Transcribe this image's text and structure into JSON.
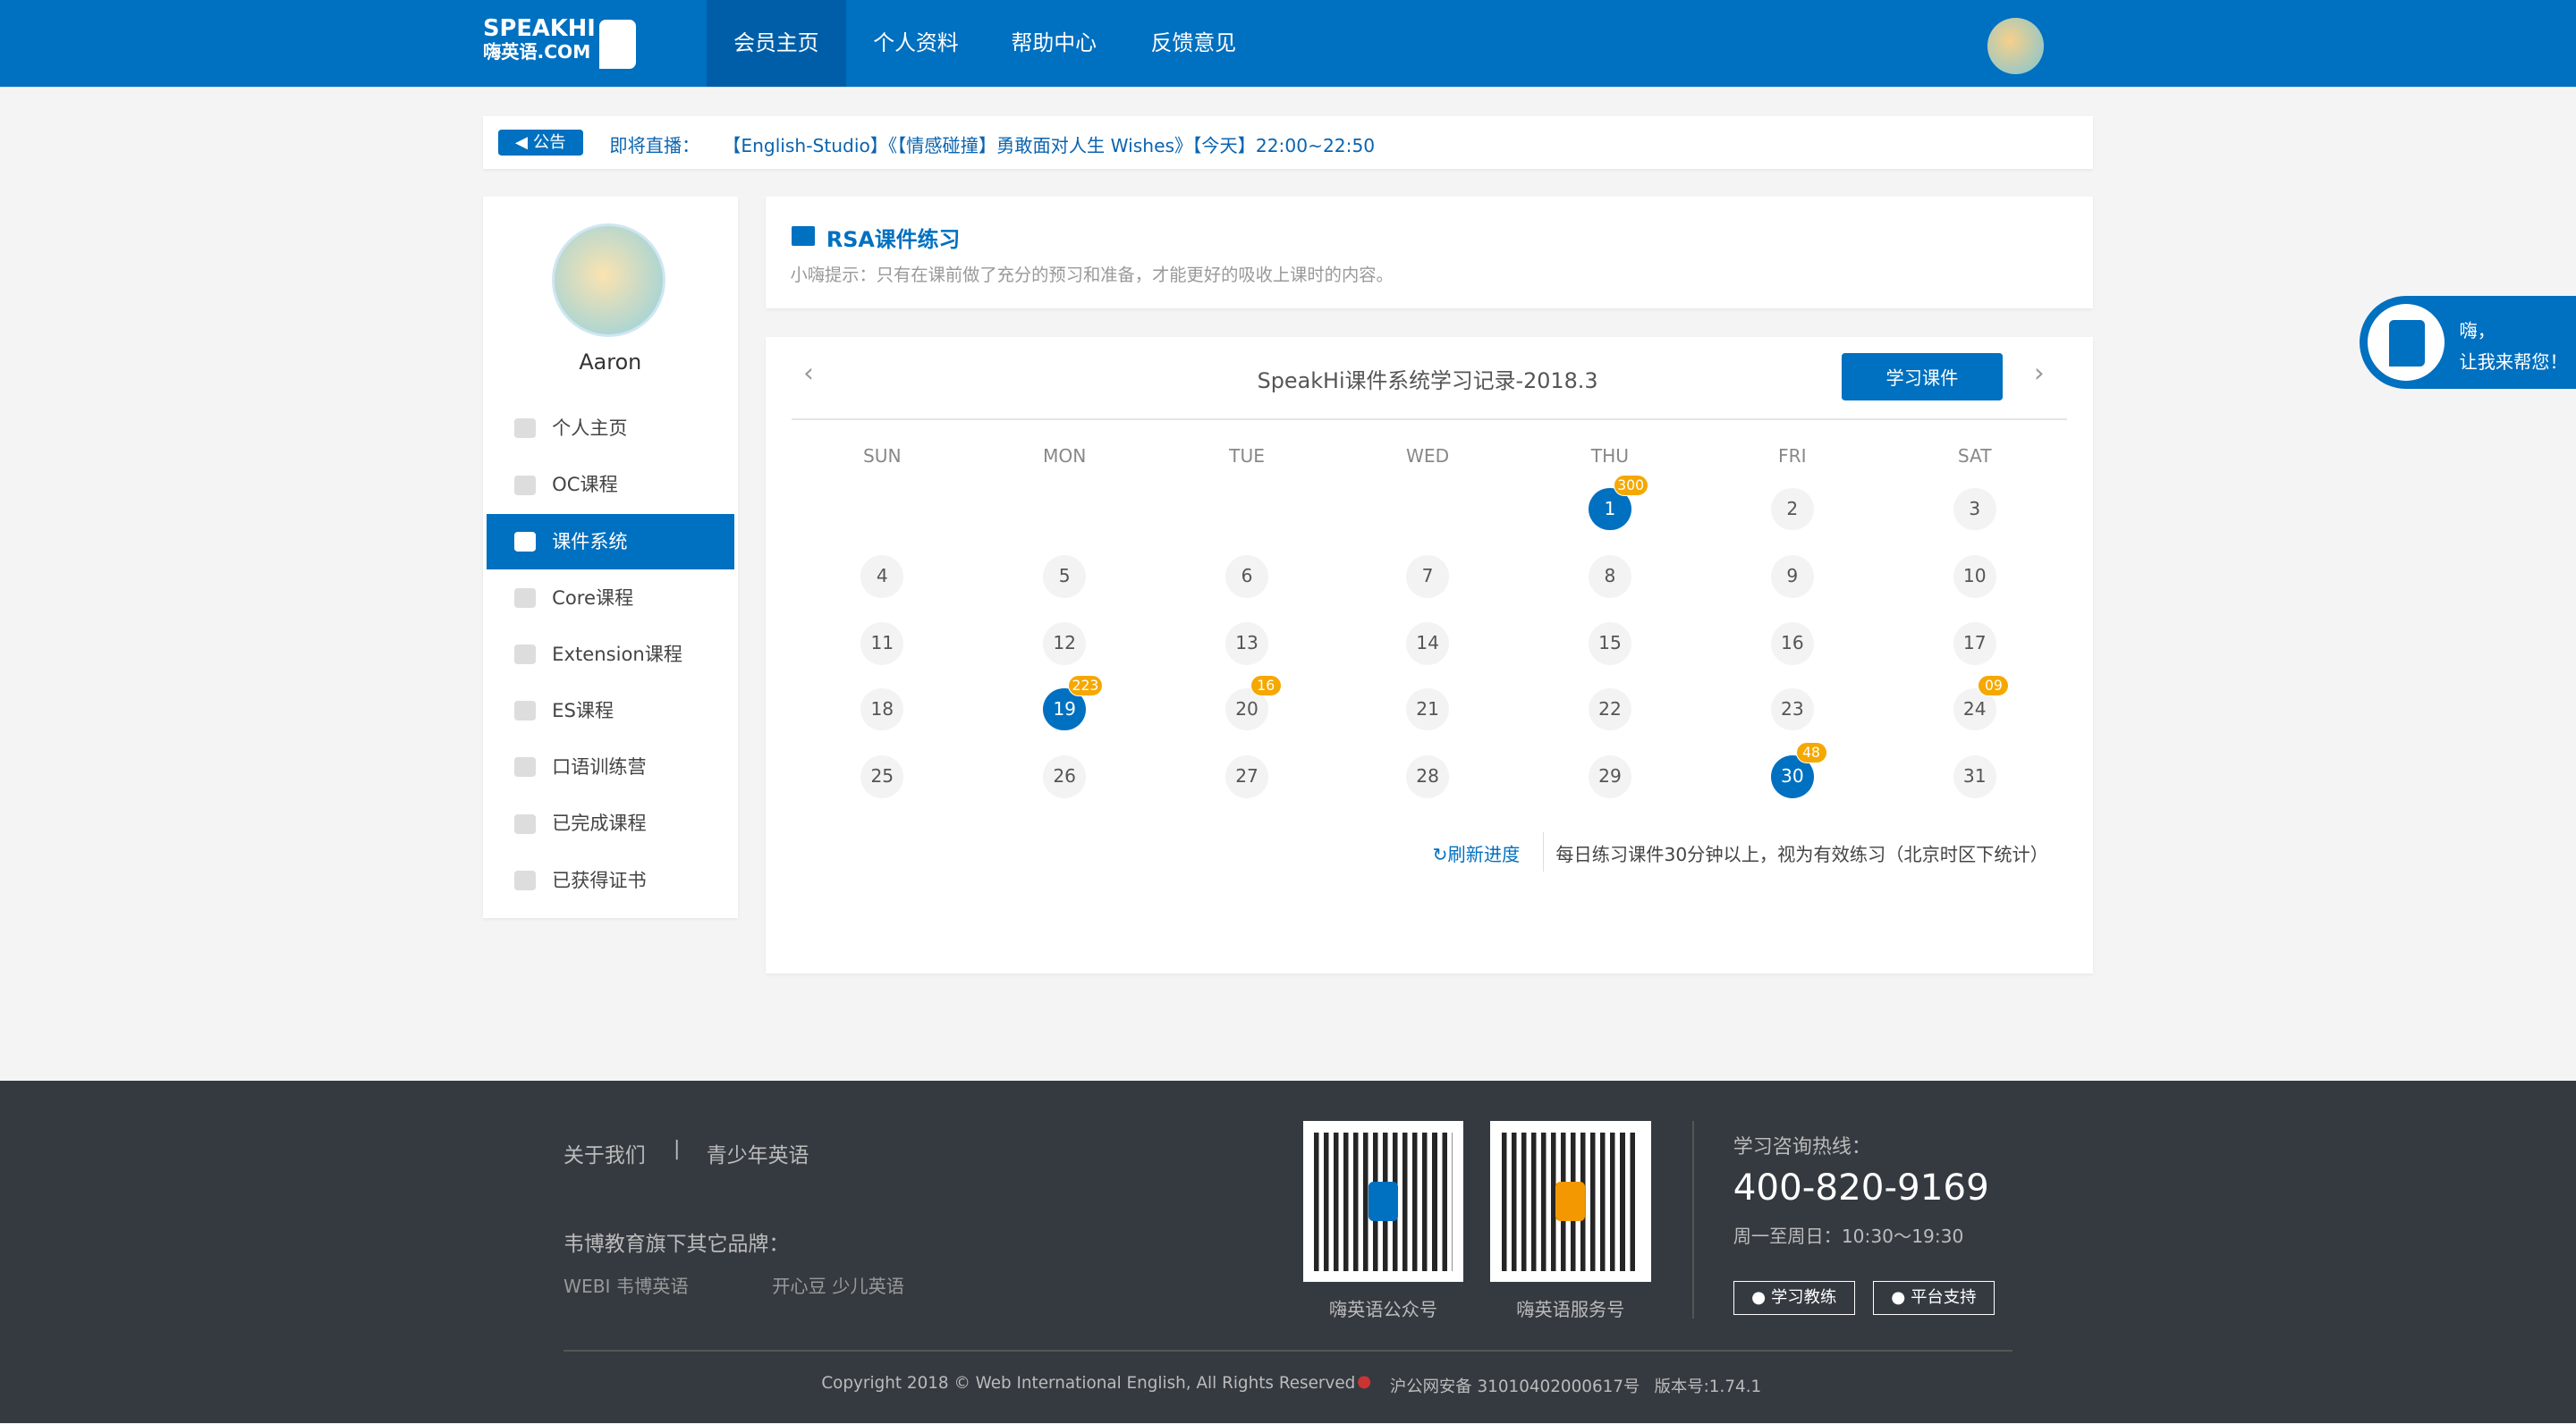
{
  "header": {
    "logo_top": "SPEAKHI",
    "logo_bottom": "嗨英语.COM",
    "nav": [
      {
        "label": "会员主页",
        "active": true
      },
      {
        "label": "个人资料"
      },
      {
        "label": "帮助中心"
      },
      {
        "label": "反馈意见"
      }
    ]
  },
  "notice": {
    "badge": "公告",
    "prefix": "即将直播：",
    "text": "【English-Studio】《【情感碰撞】勇敢面对人生 Wishes》【今天】22:00~22:50"
  },
  "sidebar": {
    "username": "Aaron",
    "items": [
      {
        "label": "个人主页"
      },
      {
        "label": "OC课程"
      },
      {
        "label": "课件系统",
        "active": true
      },
      {
        "label": "Core课程"
      },
      {
        "label": "Extension课程"
      },
      {
        "label": "ES课程"
      },
      {
        "label": "口语训练营"
      },
      {
        "label": "已完成课程"
      },
      {
        "label": "已获得证书"
      }
    ]
  },
  "section": {
    "title": "RSA课件练习",
    "hint": "小嗨提示：只有在课前做了充分的预习和准备，才能更好的吸收上课时的内容。"
  },
  "calendar": {
    "title": "SpeakHi课件系统学习记录-2018.3",
    "study_button": "学习课件",
    "weekdays": [
      "SUN",
      "MON",
      "TUE",
      "WED",
      "THU",
      "FRI",
      "SAT"
    ],
    "first_weekday": 4,
    "days_in_month": 31,
    "marked": {
      "1": {
        "count": "300",
        "active": true
      },
      "19": {
        "count": "223",
        "active": true
      },
      "20": {
        "count": "16",
        "active": false
      },
      "24": {
        "count": "09",
        "active": false
      },
      "30": {
        "count": "48",
        "active": true
      }
    },
    "refresh": "刷新进度",
    "note": "每日练习课件30分钟以上，视为有效练习（北京时区下统计）"
  },
  "helper": {
    "line1": "嗨，",
    "line2": "让我来帮您！"
  },
  "footer": {
    "links": [
      "关于我们",
      "青少年英语"
    ],
    "separator": "|",
    "brands_label": "韦博教育旗下其它品牌：",
    "brand1": "WEBI 韦博英语",
    "brand2": "开心豆 少儿英语",
    "qr1_label": "嗨英语公众号",
    "qr2_label": "嗨英语服务号",
    "hotline_label": "学习咨询热线：",
    "hotline": "400-820-9169",
    "hours": "周一至周日：10:30～19:30",
    "btn1": "学习教练",
    "btn2": "平台支持",
    "copyright": "Copyright 2018 © Web International English, All Rights Reserved",
    "icp": "沪公网安备 31010402000617号",
    "version": "版本号:1.74.1"
  },
  "colors": {
    "primary": "#0070c0",
    "badge": "#f5a800",
    "footer_bg": "#353a40"
  }
}
